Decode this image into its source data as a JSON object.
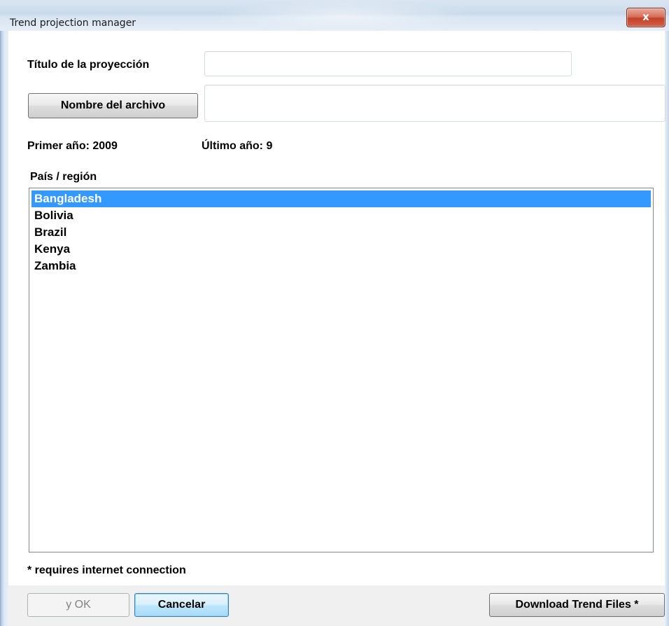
{
  "window": {
    "title": "Trend projection manager",
    "close_label": "x"
  },
  "form": {
    "title_label": "Título de la proyección",
    "title_value": "",
    "filename_button": "Nombre del archivo",
    "filename_value": "",
    "first_year_label": "Primer año: 2009",
    "last_year_label": "Último año: 9",
    "country_label": "País / región"
  },
  "countries": [
    {
      "label": "Bangladesh",
      "selected": true
    },
    {
      "label": "Bolivia",
      "selected": false
    },
    {
      "label": "Brazil",
      "selected": false
    },
    {
      "label": "Kenya",
      "selected": false
    },
    {
      "label": "Zambia",
      "selected": false
    }
  ],
  "footer": {
    "note": "* requires internet connection",
    "ok_label": "y OK",
    "cancel_label": "Cancelar",
    "download_label": "Download Trend Files *"
  }
}
